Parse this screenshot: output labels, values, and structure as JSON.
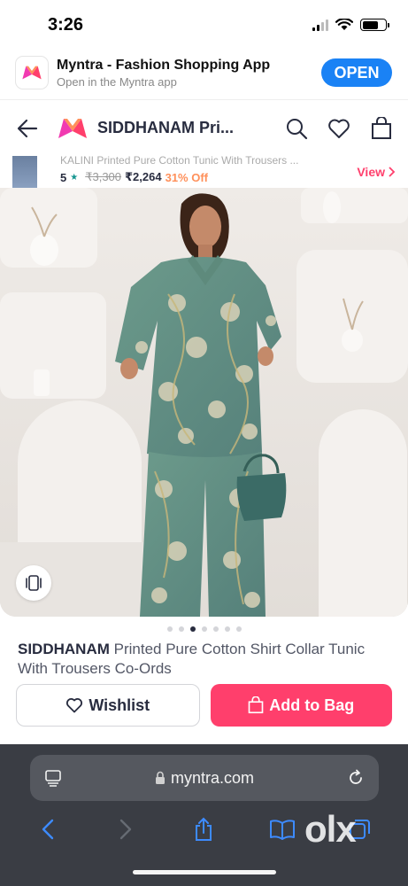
{
  "status_bar": {
    "time": "3:26"
  },
  "app_banner": {
    "name": "Myntra - Fashion Shopping App",
    "subtitle": "Open in the Myntra app",
    "open_label": "OPEN"
  },
  "header": {
    "title": "SIDDHANAM Pri..."
  },
  "similar_strip": {
    "title": "KALINI Printed Pure Cotton Tunic With Trousers ...",
    "rating": "5",
    "mrp": "₹3,300",
    "price": "₹2,264",
    "discount": "31% Off",
    "view_label": "View"
  },
  "carousel": {
    "total": 7,
    "active_index": 2
  },
  "product": {
    "brand": "SIDDHANAM",
    "title": " Printed Pure Cotton Shirt Collar Tunic With Trousers Co-Ords"
  },
  "actions": {
    "wishlist_label": "Wishlist",
    "bag_label": "Add to Bag"
  },
  "safari": {
    "url": "myntra.com"
  },
  "watermark": "olx",
  "colors": {
    "accent": "#ff3f6c",
    "open_button": "#1a82f5",
    "safari_bar": "#3a3d44",
    "dress": "#5f8f80"
  }
}
